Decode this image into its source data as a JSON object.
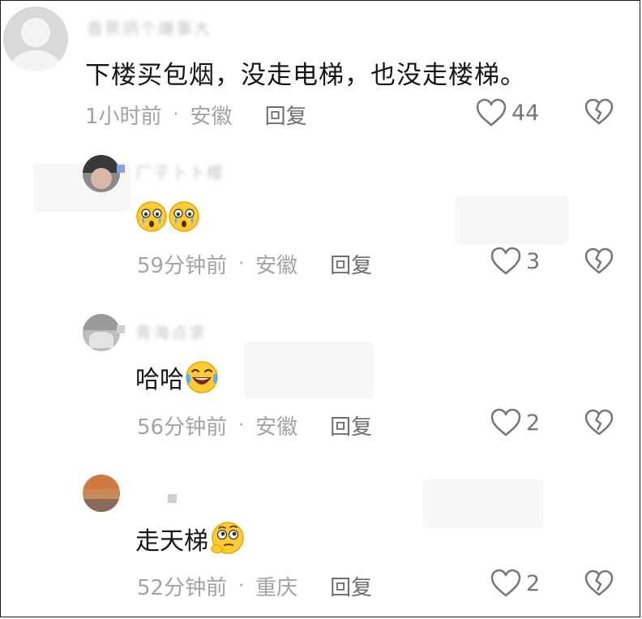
{
  "comments": [
    {
      "username": "香蕉炳个嫌事大",
      "text": "下楼买包烟，没走电梯，也没走楼梯。",
      "time": "1小时前",
      "location": "安徽",
      "reply_label": "回复",
      "likes": "44",
      "icons": {
        "like": "heart-outline-icon",
        "dislike": "broken-heart-icon"
      }
    },
    {
      "username": "厂子卜卜楼",
      "text": "",
      "emojis": [
        "crying-face-emoji",
        "crying-face-emoji"
      ],
      "time": "59分钟前",
      "location": "安徽",
      "reply_label": "回复",
      "likes": "3"
    },
    {
      "username": "青海点求",
      "text": "哈哈",
      "emojis": [
        "laughing-tears-emoji"
      ],
      "time": "56分钟前",
      "location": "安徽",
      "reply_label": "回复",
      "likes": "2"
    },
    {
      "username": "",
      "text": "走天梯",
      "emojis": [
        "thinking-face-emoji"
      ],
      "time": "52分钟前",
      "location": "重庆",
      "reply_label": "回复",
      "likes": "2"
    }
  ],
  "colors": {
    "text": "#161616",
    "meta": "#a3a3a3",
    "reply": "#6e6e6e",
    "icon": "#777777"
  }
}
